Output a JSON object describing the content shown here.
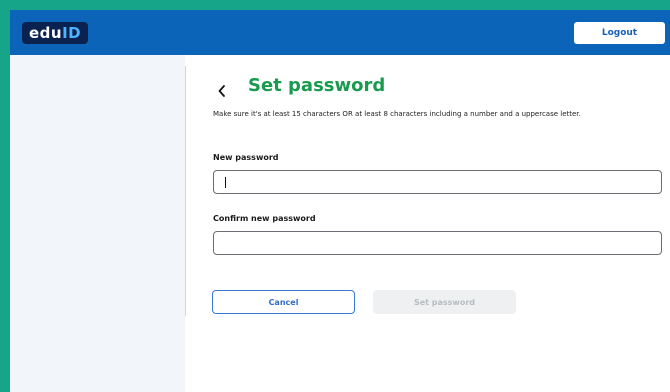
{
  "header": {
    "logo": {
      "prefix": "edu",
      "highlight": "ID"
    },
    "logout_label": "Logout"
  },
  "form": {
    "title": "Set password",
    "hint": "Make sure it's at least 15 characters OR at least 8 characters including a number and a uppercase letter.",
    "new_password": {
      "label": "New password",
      "value": ""
    },
    "confirm_password": {
      "label": "Confirm new password",
      "value": ""
    },
    "cancel_label": "Cancel",
    "submit_label": "Set password",
    "submit_enabled": false
  },
  "icons": {
    "back": "chevron-left-icon"
  },
  "colors": {
    "page_background": "#17a589",
    "header": "#0b64b8",
    "logo_background": "#0a2250",
    "title": "#1a9a4f",
    "link_blue": "#2f6fc7",
    "sidebar": "#f2f5f9"
  }
}
